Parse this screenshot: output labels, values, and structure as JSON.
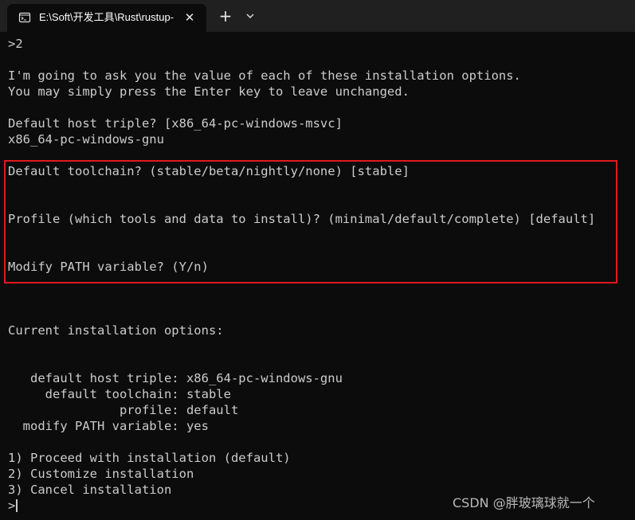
{
  "tab": {
    "title": "E:\\Soft\\开发工具\\Rust\\rustup-",
    "close_glyph": "✕",
    "icon": "terminal-icon"
  },
  "titlebar": {
    "new_tab_glyph": "+",
    "dropdown_icon": "chevron-down-icon"
  },
  "terminal": {
    "lines": [
      ">2",
      "",
      "I'm going to ask you the value of each of these installation options.",
      "You may simply press the Enter key to leave unchanged.",
      "",
      "Default host triple? [x86_64-pc-windows-msvc]",
      "x86_64-pc-windows-gnu",
      "",
      "Default toolchain? (stable/beta/nightly/none) [stable]",
      "",
      "",
      "Profile (which tools and data to install)? (minimal/default/complete) [default]",
      "",
      "",
      "Modify PATH variable? (Y/n)",
      "",
      "",
      "",
      "Current installation options:",
      "",
      "",
      "   default host triple: x86_64-pc-windows-gnu",
      "     default toolchain: stable",
      "               profile: default",
      "  modify PATH variable: yes",
      "",
      "1) Proceed with installation (default)",
      "2) Customize installation",
      "3) Cancel installation",
      ">"
    ]
  },
  "colors": {
    "background": "#0c0c0c",
    "titlebar": "#202020",
    "text": "#cccccc",
    "highlight_border": "#e0191f"
  },
  "watermark": "CSDN @胖玻璃球就一个"
}
